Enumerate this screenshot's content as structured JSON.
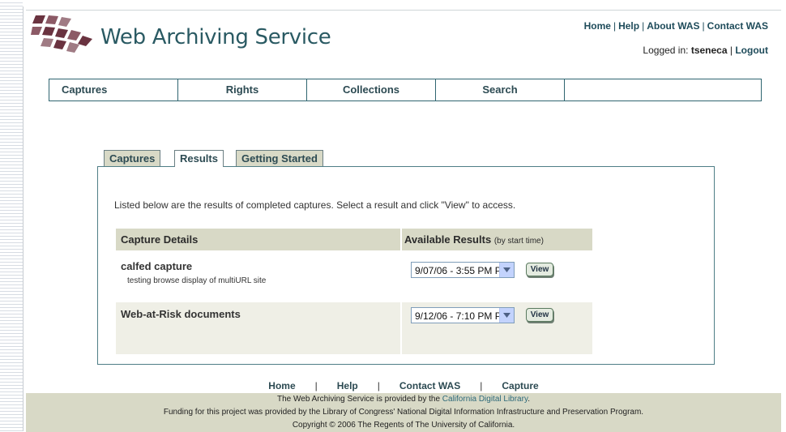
{
  "header": {
    "app_title": "Web Archiving Service",
    "top_links": [
      "Home",
      "Help",
      "About WAS",
      "Contact WAS"
    ],
    "login_prefix": "Logged in:",
    "username": "tseneca",
    "logout": "Logout"
  },
  "nav": [
    "Captures",
    "Rights",
    "Collections",
    "Search",
    ""
  ],
  "tabs": [
    "Captures",
    "Results",
    "Getting Started"
  ],
  "active_tab": "Results",
  "main": {
    "intro": "Listed below are the results of completed captures. Select a result and click \"View\" to access.",
    "col_details": "Capture Details",
    "col_results": "Available Results",
    "col_results_note": "(by start time)",
    "rows": [
      {
        "title": "calfed capture",
        "desc": "testing browse display of multiURL site",
        "selected": "9/07/06 - 3:55 PM P",
        "button": "View"
      },
      {
        "title": "Web-at-Risk documents",
        "desc": "",
        "selected": "9/12/06 - 7:10 PM P",
        "button": "View"
      }
    ]
  },
  "footer": {
    "links": [
      "Home",
      "Help",
      "Contact WAS",
      "Capture"
    ],
    "line1_prefix": "The Web Archiving Service is provided by the ",
    "line1_link": "California Digital Library",
    "line1_suffix": ".",
    "line2": "Funding for this project was provided by the Library of Congress' National Digital Information Infrastructure and Preservation Program.",
    "line3": "Copyright © 2006 The Regents of The University of California."
  },
  "colors": {
    "accent": "#2a5a63",
    "tab_bg": "#d8d9c6",
    "logo_dark": "#6a3340",
    "logo_light": "#a07b84"
  }
}
